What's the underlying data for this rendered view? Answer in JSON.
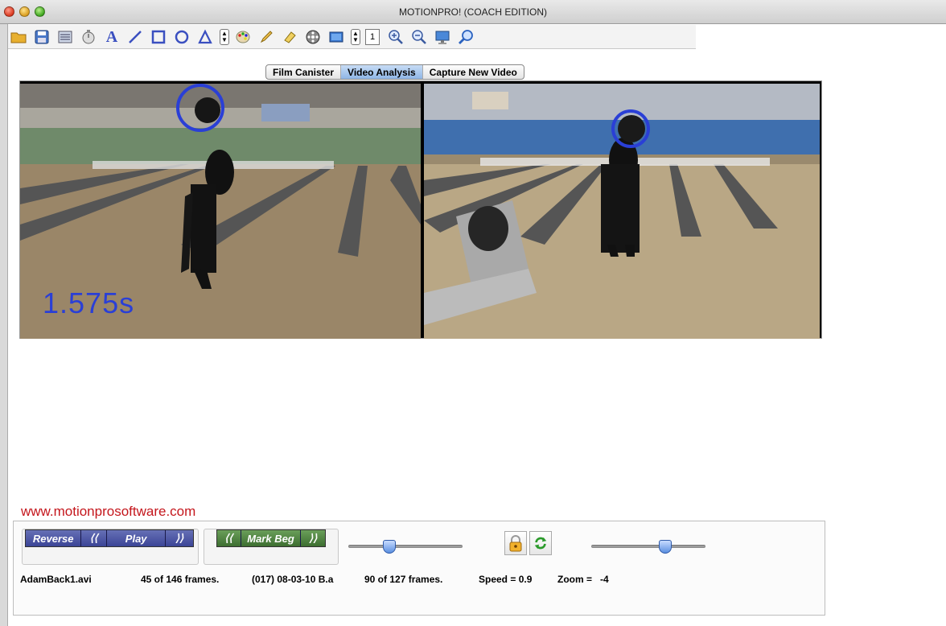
{
  "window": {
    "title": "MOTIONPRO! (COACH EDITION)"
  },
  "toolbar": {
    "icons": [
      "open-folder-icon",
      "save-icon",
      "film-list-icon",
      "stopwatch-icon",
      "text-tool-icon",
      "line-tool-icon",
      "rectangle-tool-icon",
      "circle-tool-icon",
      "triangle-tool-icon",
      "stepper-icon",
      "color-palette-icon",
      "pencil-icon",
      "eraser-icon",
      "reel-icon",
      "video-frame-icon",
      "stepper-icon",
      "zoom-in-icon",
      "zoom-out-icon",
      "monitor-icon",
      "search-icon"
    ],
    "text_tool_glyph": "A",
    "line_width_value": "1"
  },
  "tabs": [
    {
      "label": "Film Canister",
      "active": false
    },
    {
      "label": "Video Analysis",
      "active": true
    },
    {
      "label": "Capture New Video",
      "active": false
    }
  ],
  "video_left": {
    "timer_text": "1.575s"
  },
  "website": "www.motionprosoftware.com",
  "controls": {
    "reverse_label": "Reverse",
    "prev_left": "⟨⟨",
    "play_label": "Play",
    "next_left": "⟩⟩",
    "prev_mark": "⟨⟨",
    "mark_beg_label": "Mark Beg",
    "next_mark": "⟩⟩",
    "slider1_position": 0.34,
    "slider2_position": 0.67
  },
  "status": {
    "file1": "AdamBack1.avi",
    "frames1": "45 of 146 frames.",
    "file2": "(017) 08-03-10 B.a",
    "frames2": "90 of 127 frames.",
    "speed": "Speed = 0.9",
    "zoom": "Zoom =   -4"
  },
  "colors": {
    "timer": "#2a3fd6",
    "website": "#c4161c",
    "tab_active": "#8fb6e6",
    "play_buttons": "#3b4496",
    "mark_buttons": "#3d6e30"
  }
}
